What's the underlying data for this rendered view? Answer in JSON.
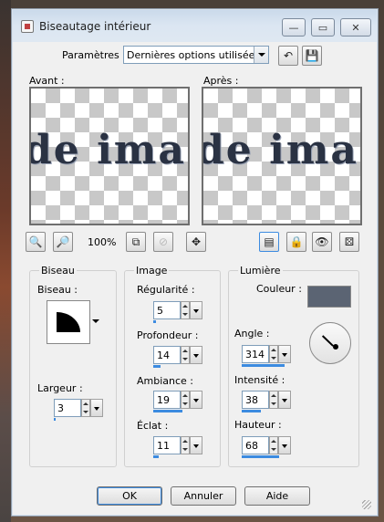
{
  "window": {
    "title": "Biseautage intérieur"
  },
  "titlebar": {
    "minimize": "—",
    "maximize": "▭",
    "close": "✕"
  },
  "params": {
    "label": "Paramètres :",
    "value": "Dernières options utilisées"
  },
  "preview": {
    "before_label": "Avant :",
    "after_label": "Après :",
    "sample_text": "de ima"
  },
  "zoom": {
    "value": "100%"
  },
  "bevel": {
    "group_title": "Biseau",
    "bevel_label": "Biseau :",
    "width_label": "Largeur :",
    "width_value": "3",
    "width_level": 3
  },
  "image": {
    "group_title": "Image",
    "smoothness_label": "Régularité :",
    "smoothness_value": "5",
    "smoothness_level": 5,
    "depth_label": "Profondeur :",
    "depth_value": "14",
    "depth_level": 14,
    "ambience_label": "Ambiance :",
    "ambience_value": "19",
    "ambience_level": 59,
    "shininess_label": "Éclat :",
    "shininess_value": "11",
    "shininess_level": 11
  },
  "light": {
    "group_title": "Lumière",
    "color_label": "Couleur :",
    "color_hex": "#5b6473",
    "angle_label": "Angle :",
    "angle_value": "314",
    "angle_level": 87,
    "intensity_label": "Intensité :",
    "intensity_value": "38",
    "intensity_level": 38,
    "elevation_label": "Hauteur :",
    "elevation_value": "68",
    "elevation_level": 76
  },
  "footer": {
    "ok": "OK",
    "cancel": "Annuler",
    "help": "Aide"
  }
}
